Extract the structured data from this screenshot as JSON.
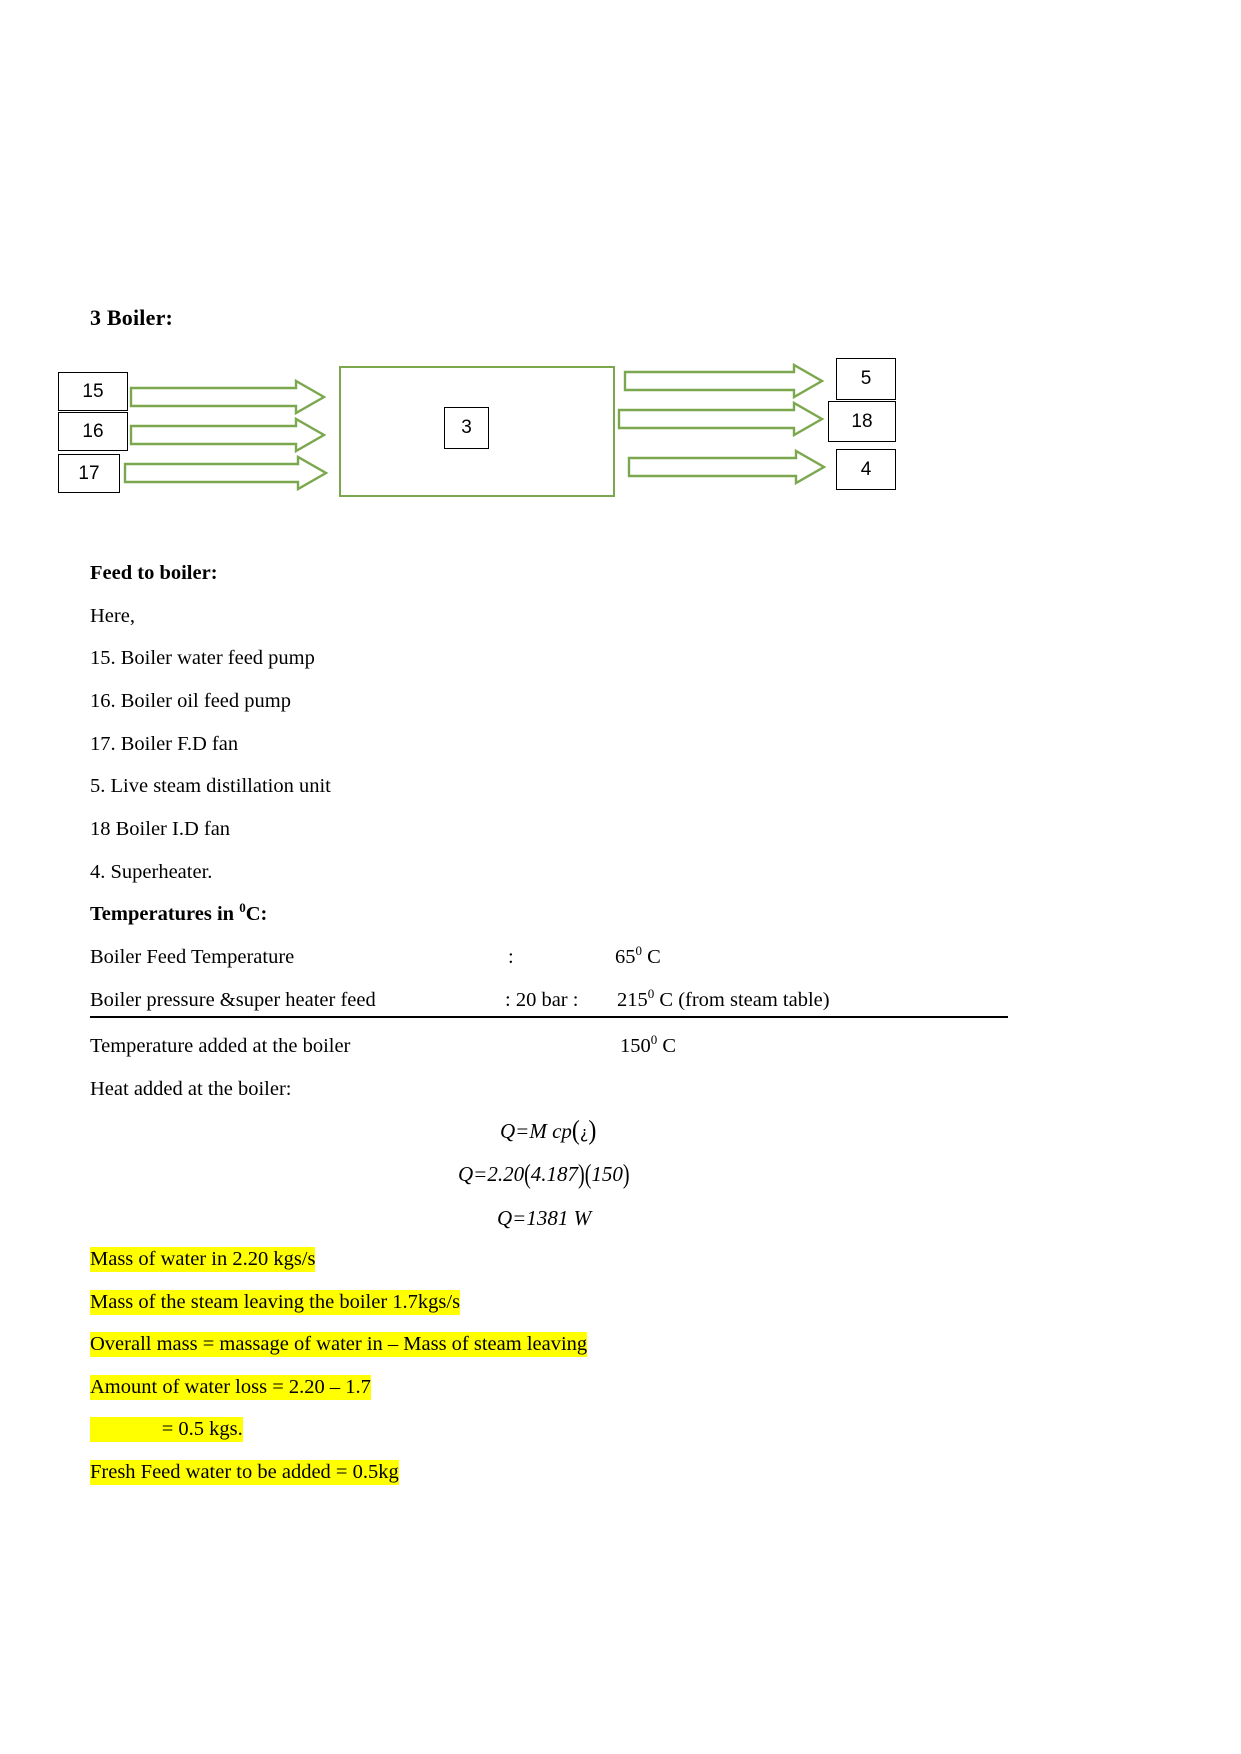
{
  "document": {
    "section_heading": "3 Boiler:",
    "diagram": {
      "inputs": [
        {
          "id": "15"
        },
        {
          "id": "16"
        },
        {
          "id": "17"
        }
      ],
      "center": {
        "id": "3"
      },
      "outputs": [
        {
          "id": "5"
        },
        {
          "id": "18"
        },
        {
          "id": "4"
        }
      ],
      "arrow_color": "#7ba84f",
      "box_border_color": "#000000"
    },
    "feed_heading": "Feed to boiler:",
    "here_label": "Here,",
    "legend": [
      "15. Boiler water feed pump",
      "16. Boiler oil feed pump",
      "17. Boiler F.D fan",
      "5. Live steam distillation unit",
      "18 Boiler I.D fan",
      "4. Superheater."
    ],
    "temperatures_heading": {
      "text_before": "Temperatures in ",
      "superscript": "0",
      "text_after": "C:"
    },
    "rows": [
      {
        "label": "Boiler Feed Temperature",
        "colon": ":",
        "value_num": "65",
        "value_sup": "0",
        "value_unit": " C",
        "value_note": ""
      },
      {
        "label": "Boiler pressure &super heater feed",
        "colon": ": 20 bar :",
        "value_num": "215",
        "value_sup": "0",
        "value_unit": " C",
        "value_note": " (from steam table)"
      },
      {
        "label": "Temperature added at the boiler",
        "colon": "",
        "value_num": "150",
        "value_sup": "0",
        "value_unit": " C",
        "value_note": ""
      }
    ],
    "heat_added_label": "Heat added at the boiler:",
    "equations": [
      {
        "lhs": "Q=",
        "rhs": "M cp",
        "tail": "¿"
      },
      {
        "lhs": "Q=",
        "rhs": "2.20",
        "a": "4.187",
        "b": "150"
      },
      {
        "lhs": "Q=",
        "rhs": "1381 W"
      }
    ],
    "highlighted": [
      "Mass of water in 2.20 kgs/s",
      "Mass of the steam leaving the boiler 1.7kgs/s",
      "Overall mass = massage of water in – Mass of steam leaving",
      "Amount of water loss = 2.20 – 1.7",
      "= 0.5 kgs.",
      "Fresh Feed water to be added = 0.5kg"
    ],
    "highlight_color": "#ffff00"
  }
}
